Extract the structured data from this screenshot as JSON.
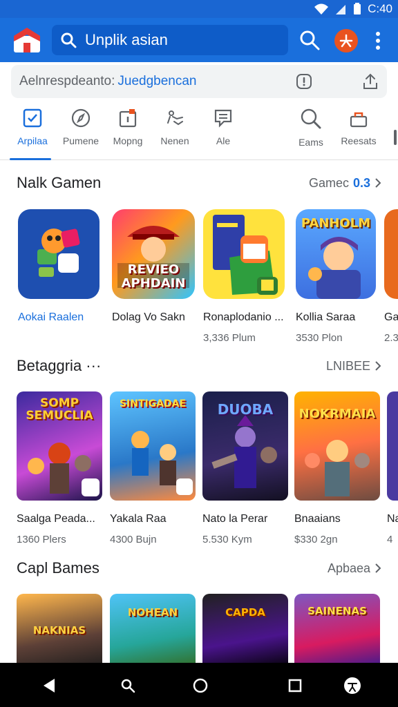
{
  "status_bar": {
    "time": "C:40"
  },
  "app_bar": {
    "search_text": "Unplik asian"
  },
  "address_bar": {
    "prefix": "Aelnrespdeanto:",
    "link": "Juedgbencan"
  },
  "tabs": [
    {
      "label": "Arpilaa",
      "icon": "check-square-icon",
      "active": true
    },
    {
      "label": "Pumene",
      "icon": "compass-icon"
    },
    {
      "label": "Mopng",
      "icon": "calendar-icon"
    },
    {
      "label": "Nenen",
      "icon": "route-icon"
    },
    {
      "label": "Ale",
      "icon": "document-icon"
    },
    {
      "label": "Eams",
      "icon": "magnify-icon"
    },
    {
      "label": "Reesats",
      "icon": "bag-icon"
    }
  ],
  "sections": [
    {
      "title": "Nalk Gamen",
      "link": "Gamec",
      "link_badge": "0.3",
      "items": [
        {
          "name": "Aokai Raalen",
          "meta": "",
          "art_title": "",
          "highlight": true
        },
        {
          "name": "Dolag Vo Sakn",
          "meta": "",
          "art_title": "REVIEO APHDAIN"
        },
        {
          "name": "Ronaplodanio ...",
          "meta": "3,336 Plum",
          "art_title": ""
        },
        {
          "name": "Kollia Saraa",
          "meta": "3530 Plon",
          "art_title": "PANHOLM"
        },
        {
          "name": "Ga",
          "meta": "2.3",
          "art_title": ""
        }
      ]
    },
    {
      "title": "Betaggria ···",
      "link": "LNIBEE",
      "items": [
        {
          "name": "Saalga Peada...",
          "meta": "1360 Plers",
          "art_title": "SOMP SEMUCLIA"
        },
        {
          "name": "Yakala Raa",
          "meta": "4300 Bujn",
          "art_title": "SINTIGADAE"
        },
        {
          "name": "Nato la Perar",
          "meta": "5.530 Kym",
          "art_title": "DUOBA"
        },
        {
          "name": "Bnaaians",
          "meta": "$330 2gn",
          "art_title": "NOKRMAIA"
        },
        {
          "name": "Na",
          "meta": "4",
          "art_title": ""
        }
      ]
    },
    {
      "title": "Capl Bames",
      "link": "Apbaea",
      "items": [
        {
          "art_title": "NAKNIAS"
        },
        {
          "art_title": "NOHEAN"
        },
        {
          "art_title": "CAPDA"
        },
        {
          "art_title": "SAINENAS"
        }
      ]
    }
  ],
  "colors": {
    "brand": "#1a6fdc",
    "status": "#1a66d2",
    "avatar": "#e9531f"
  }
}
